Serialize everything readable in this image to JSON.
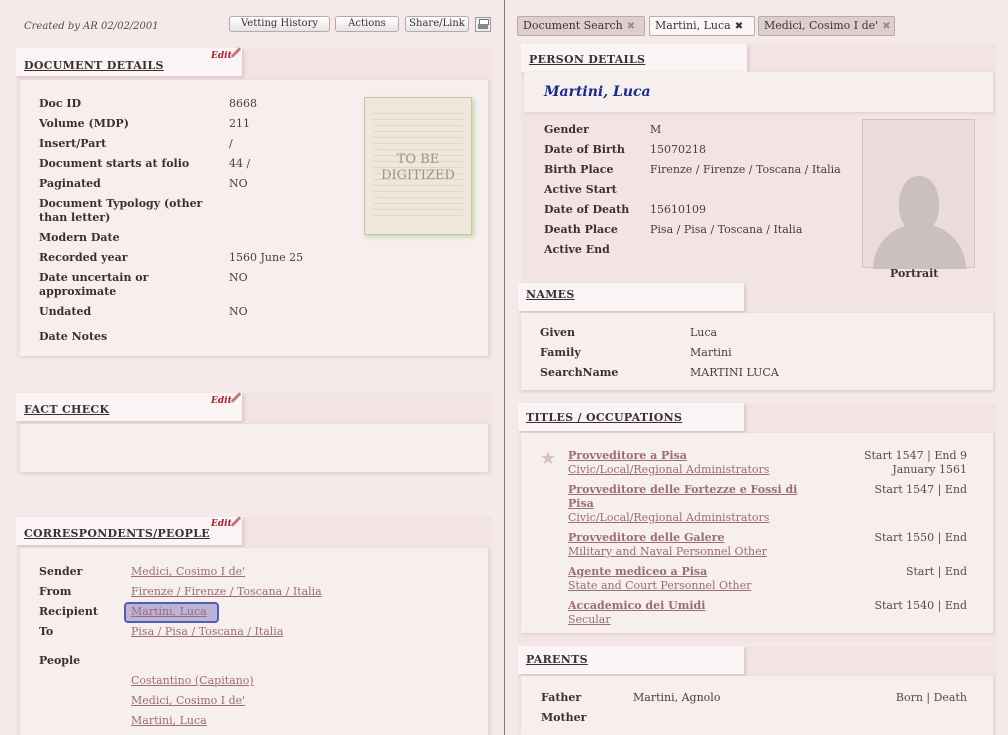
{
  "header": {
    "created": "Created by AR 02/02/2001",
    "buttons": {
      "vetting": "Vetting History",
      "actions": "Actions",
      "share": "Share/Link"
    }
  },
  "tabs": [
    {
      "label": "Document Search"
    },
    {
      "label": "Martini, Luca"
    },
    {
      "label": "Medici, Cosimo I de'"
    }
  ],
  "edit_label": "Edit",
  "document": {
    "title": "DOCUMENT DETAILS",
    "image_text_1": "TO BE",
    "image_text_2": "DIGITIZED",
    "fields": [
      {
        "label": "Doc ID",
        "value": "8668"
      },
      {
        "label": "Volume (MDP)",
        "value": "211"
      },
      {
        "label": "Insert/Part",
        "value": "/"
      },
      {
        "label": "Document starts at folio",
        "value": "44 /"
      },
      {
        "label": "Paginated",
        "value": "NO"
      },
      {
        "label": "Document Typology (other than letter)",
        "value": ""
      },
      {
        "label": "Modern Date",
        "value": ""
      },
      {
        "label": "Recorded year",
        "value": "1560 June 25"
      },
      {
        "label": "Date uncertain or approximate",
        "value": "NO"
      },
      {
        "label": "Undated",
        "value": "NO"
      },
      {
        "label": "Date Notes",
        "value": ""
      }
    ]
  },
  "factcheck": {
    "title": "FACT CHECK"
  },
  "correspondents": {
    "title": "CORRESPONDENTS/PEOPLE",
    "sender_label": "Sender",
    "sender": "Medici, Cosimo I de'",
    "from_label": "From",
    "from": "Firenze / Firenze / Toscana / Italia",
    "recipient_label": "Recipient",
    "recipient": "Martini, Luca",
    "to_label": "To",
    "to": "Pisa / Pisa / Toscana / Italia",
    "people_label": "People",
    "people": [
      "Costantino (Capitano)",
      "Medici, Cosimo I de'",
      "Martini, Luca"
    ]
  },
  "person": {
    "title": "PERSON DETAILS",
    "name": "Martini, Luca",
    "portrait_caption": "Portrait",
    "fields": [
      {
        "label": "Gender",
        "value": "M"
      },
      {
        "label": "Date of Birth",
        "value": "15070218"
      },
      {
        "label": "Birth Place",
        "value": "Firenze / Firenze / Toscana / Italia"
      },
      {
        "label": "Active Start",
        "value": ""
      },
      {
        "label": "Date of Death",
        "value": "15610109"
      },
      {
        "label": "Death Place",
        "value": "Pisa / Pisa / Toscana / Italia"
      },
      {
        "label": "Active End",
        "value": ""
      }
    ]
  },
  "names": {
    "title": "NAMES",
    "fields": [
      {
        "label": "Given",
        "value": "Luca"
      },
      {
        "label": "Family",
        "value": "Martini"
      },
      {
        "label": "SearchName",
        "value": "MARTINI LUCA"
      }
    ]
  },
  "titles": {
    "title": "TITLES / OCCUPATIONS",
    "items": [
      {
        "title": "Provveditore a Pisa",
        "category": "Civic/Local/Regional Administrators",
        "dates_1": "Start 1547 | End 9",
        "dates_2": "January 1561"
      },
      {
        "title": "Provveditore  delle  Fortezze  e  Fossi  di",
        "title_2": "Pisa",
        "category": "Civic/Local/Regional Administrators",
        "dates_1": "Start 1547 | End"
      },
      {
        "title": "Provveditore delle Galere",
        "category": "Military and Naval Personnel Other",
        "dates_1": "Start 1550 | End"
      },
      {
        "title": "Agente mediceo a Pisa",
        "category": "State and Court Personnel Other",
        "dates_1": "Start | End"
      },
      {
        "title": "Accademico dei Umidi",
        "category": "Secular",
        "dates_1": "Start 1540 | End"
      }
    ]
  },
  "parents": {
    "title": "PARENTS",
    "father_label": "Father",
    "father": "Martini, Agnolo",
    "father_dates": "Born | Death",
    "mother_label": "Mother"
  }
}
